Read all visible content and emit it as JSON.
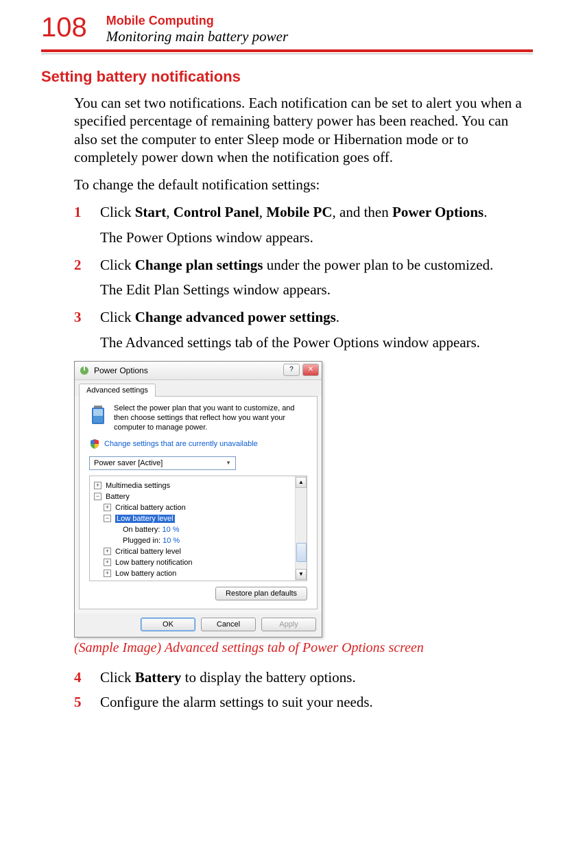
{
  "header": {
    "page_number": "108",
    "chapter_title": "Mobile Computing",
    "chapter_subtitle": "Monitoring main battery power"
  },
  "section_title": "Setting battery notifications",
  "intro_paragraph": "You can set two notifications. Each notification can be set to alert you when a specified percentage of remaining battery power has been reached. You can also set the computer to enter Sleep mode or Hibernation mode or to completely power down when the notification goes off.",
  "lead_in": "To change the default notification settings:",
  "steps": [
    {
      "num": "1",
      "parts": [
        "Click ",
        "Start",
        ", ",
        "Control Panel",
        ", ",
        "Mobile PC",
        ", and then ",
        "Power Options",
        "."
      ],
      "after": "The Power Options window appears."
    },
    {
      "num": "2",
      "parts": [
        "Click ",
        "Change plan settings",
        " under the power plan to be customized."
      ],
      "after": "The Edit Plan Settings window appears."
    },
    {
      "num": "3",
      "parts": [
        "Click ",
        "Change advanced power settings",
        "."
      ],
      "after": "The Advanced settings tab of the Power Options window appears."
    }
  ],
  "caption": "(Sample Image) Advanced settings tab of Power Options screen",
  "steps2": [
    {
      "num": "4",
      "parts": [
        "Click ",
        "Battery",
        " to display the battery options."
      ]
    },
    {
      "num": "5",
      "parts": [
        "Configure the alarm settings to suit your needs."
      ]
    }
  ],
  "dialog": {
    "title": "Power Options",
    "help_label": "?",
    "close_label": "✕",
    "tab_label": "Advanced settings",
    "description": "Select the power plan that you want to customize, and then choose settings that reflect how you want your computer to manage power.",
    "link": "Change settings that are currently unavailable",
    "combo_value": "Power saver [Active]",
    "tree": {
      "multimedia": "Multimedia settings",
      "battery": "Battery",
      "critical_action": "Critical battery action",
      "low_level": "Low battery level",
      "on_battery_label": "On battery:",
      "on_battery_value": "10 %",
      "plugged_label": "Plugged in:",
      "plugged_value": "10 %",
      "critical_level": "Critical battery level",
      "low_notification": "Low battery notification",
      "low_action": "Low battery action"
    },
    "restore_btn": "Restore plan defaults",
    "ok_btn": "OK",
    "cancel_btn": "Cancel",
    "apply_btn": "Apply"
  }
}
